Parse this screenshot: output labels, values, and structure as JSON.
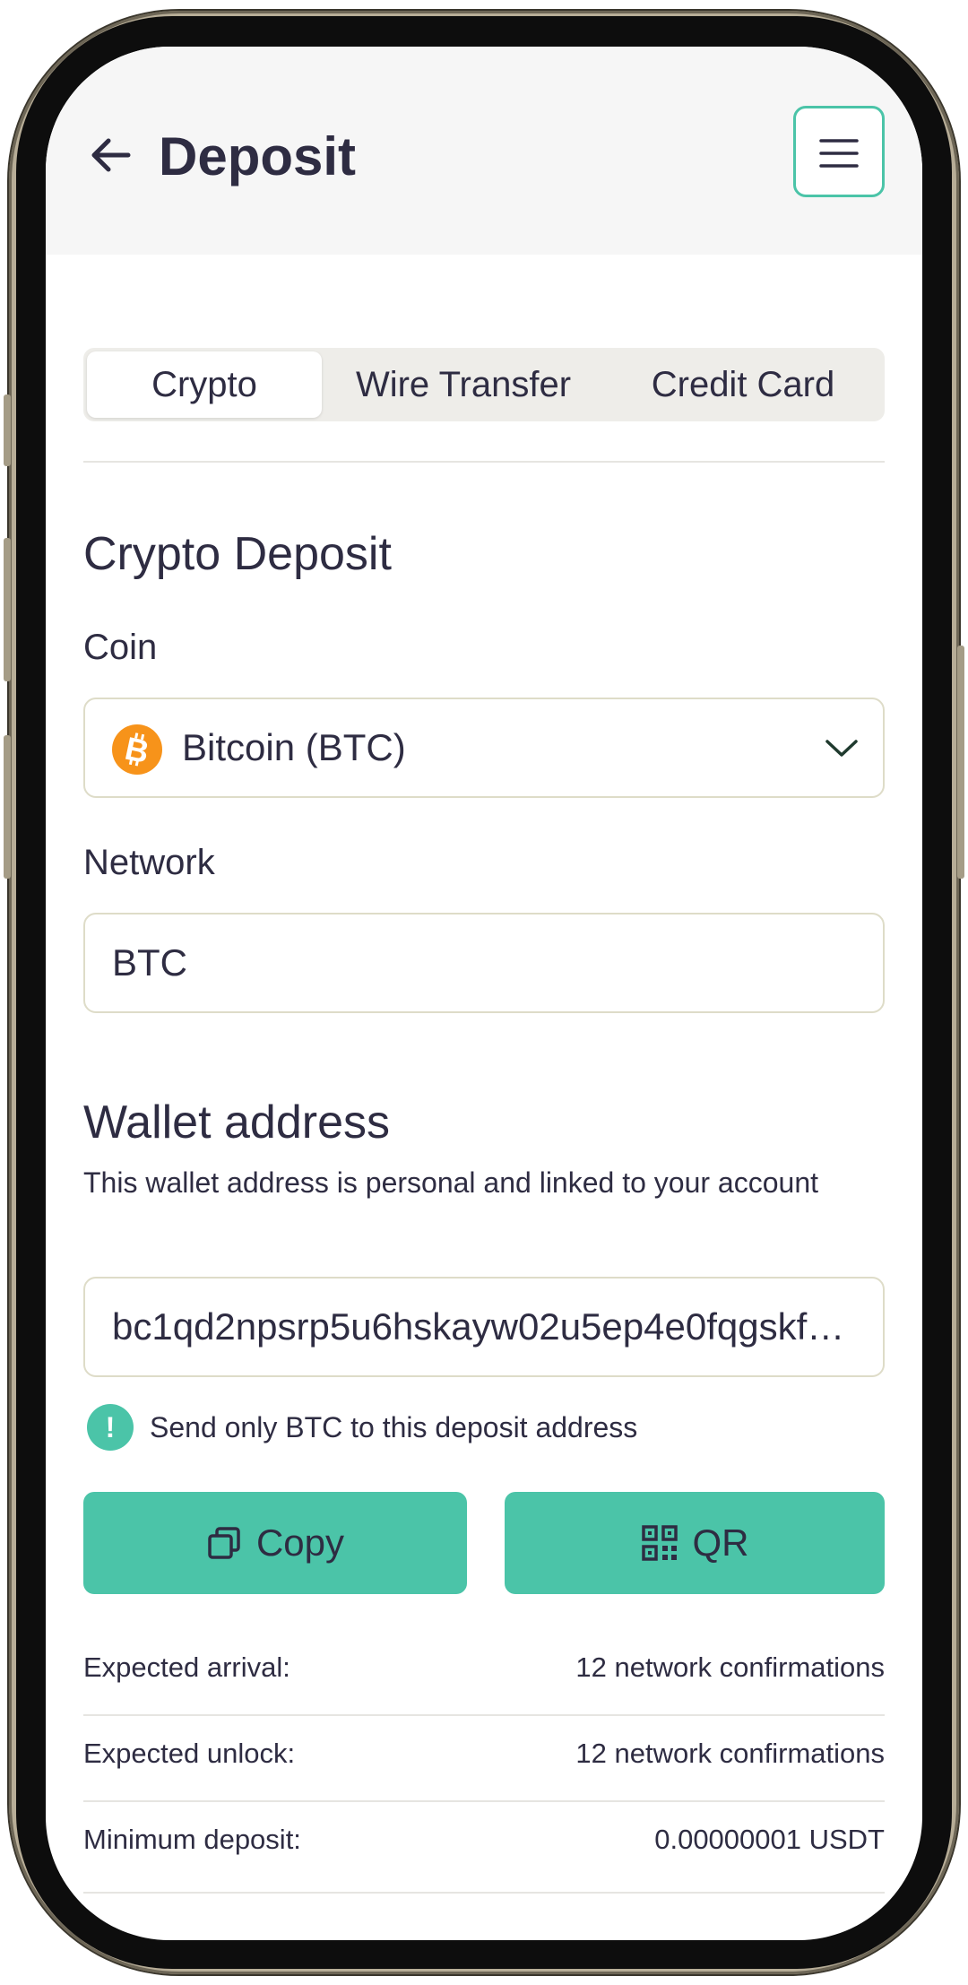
{
  "header": {
    "title": "Deposit"
  },
  "tabs": [
    {
      "label": "Crypto",
      "active": true
    },
    {
      "label": "Wire Transfer",
      "active": false
    },
    {
      "label": "Credit Card",
      "active": false
    }
  ],
  "crypto": {
    "title": "Crypto Deposit",
    "coin_label": "Coin",
    "coin_value": "Bitcoin (BTC)",
    "network_label": "Network",
    "network_value": "BTC"
  },
  "wallet": {
    "title": "Wallet address",
    "description": "This wallet address is personal and linked to your account",
    "address": "bc1qd2npsrp5u6hskayw02u5ep4e0fqgskf…",
    "warning": "Send only BTC to this deposit address",
    "copy_label": "Copy",
    "qr_label": "QR"
  },
  "info": [
    {
      "label": "Expected arrival:",
      "value": "12 network confirmations"
    },
    {
      "label": "Expected unlock:",
      "value": "12 network confirmations"
    },
    {
      "label": "Minimum deposit:",
      "value": "0.00000001 USDT"
    }
  ],
  "colors": {
    "accent": "#4bc4a8",
    "bitcoin": "#f7931a",
    "text": "#2e2c42"
  }
}
